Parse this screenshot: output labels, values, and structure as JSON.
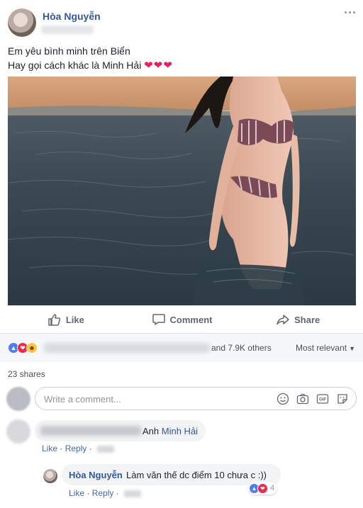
{
  "post": {
    "author": "Hòa Nguyễn",
    "text_line1": "Em yêu bình minh trên Biển",
    "text_line2": "Hay gọi cách khác là Minh Hải",
    "hearts": "❤❤❤"
  },
  "actions": {
    "like": "Like",
    "comment": "Comment",
    "share": "Share"
  },
  "reactions": {
    "others_text": "and 7.9K others",
    "sort_label": "Most relevant",
    "icons": [
      "like-icon",
      "love-icon",
      "haha-icon"
    ]
  },
  "shares_text": "23 shares",
  "composer": {
    "placeholder": "Write a comment...",
    "tools": [
      "emoji-icon",
      "camera-icon",
      "gif-icon",
      "sticker-icon"
    ]
  },
  "comments": [
    {
      "text_prefix": "Anh",
      "mention": "Minh Hải",
      "like_label": "Like",
      "reply_label": "Reply",
      "separator": "·"
    }
  ],
  "reply": {
    "author": "Hòa Nguyễn",
    "text": "Làm văn thế dc điểm 10 chưa c :))",
    "reaction_count": "4",
    "like_label": "Like",
    "reply_label": "Reply",
    "separator": "·"
  },
  "colors": {
    "link": "#365899",
    "accent": "#4267b2",
    "heart": "#e0245e",
    "muted": "#606770"
  }
}
